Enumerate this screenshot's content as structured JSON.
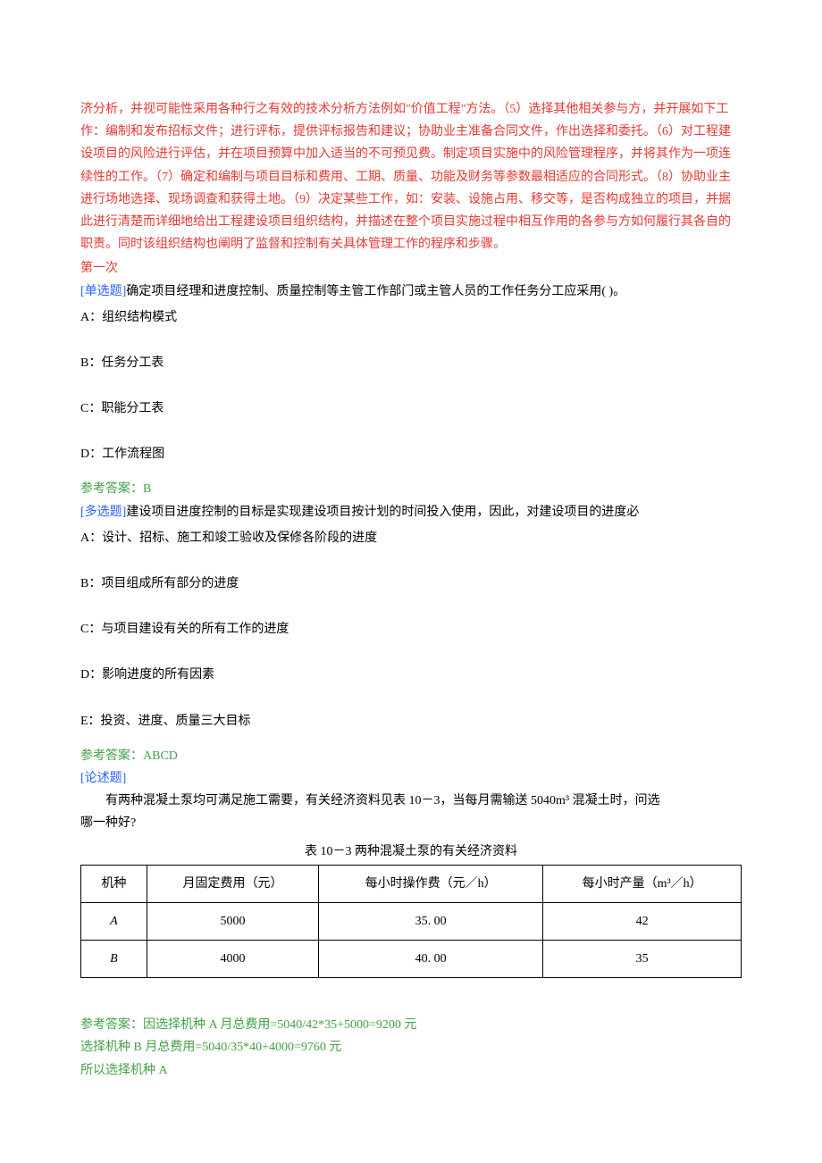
{
  "intro": {
    "red_paragraph": "济分析，并视可能性采用各种行之有效的技术分析方法例如\"价值工程\"方法。（5）选择其他相关参与方，并开展如下工作：编制和发布招标文件；进行评标，提供评标报告和建议；协助业主准备合同文件，作出选择和委托。（6）对工程建设项目的风险进行评估，并在项目预算中加入适当的不可预见费。制定项目实施中的风险管理程序，并将其作为一项连续性的工作。（7）确定和编制与项目目标和费用、工期、质量、功能及财务等参数最相适应的合同形式。（8）协助业主进行场地选择、现场调查和获得土地。（9）决定某些工作，如：安装、设施占用、移交等，是否构成独立的项目，并据此进行清楚而详细地给出工程建设项目组织结构，并描述在整个项目实施过程中相互作用的各参与方如何履行其各自的职责。同时该组织结构也阐明了监督和控制有关具体管理工作的程序和步骤。",
    "section_title": "第一次"
  },
  "q1": {
    "tag": "[单选题]",
    "stem": "确定项目经理和进度控制、质量控制等主管工作部门或主管人员的工作任务分工应采用( )。",
    "optA": "A：组织结构模式",
    "optB": "B：任务分工表",
    "optC": "C：职能分工表",
    "optD": "D：工作流程图",
    "answer_label": "参考答案：",
    "answer_value": "B"
  },
  "q2": {
    "tag": "[多选题]",
    "stem": "建设项目进度控制的目标是实现建设项目按计划的时间投入使用，因此，对建设项目的进度必",
    "optA": "A：设计、招标、施工和竣工验收及保修各阶段的进度",
    "optB": "B：项目组成所有部分的进度",
    "optC": "C：与项目建设有关的所有工作的进度",
    "optD": "D：影响进度的所有因素",
    "optE": "E：投资、进度、质量三大目标",
    "answer_label": "参考答案：",
    "answer_value": "ABCD"
  },
  "q3": {
    "tag": "[论述题]",
    "stem_line1": "有两种混凝土泵均可满足施工需要，有关经济资料见表 10－3，当每月需输送 5040m³ 混凝土时，问选",
    "stem_line2": "哪一种好?",
    "answer1": "参考答案：因选择机种 A 月总费用=5040/42*35+5000=9200 元",
    "answer2": "选择机种 B 月总费用=5040/35*40+4000=9760 元",
    "answer3": "所以选择机种 A"
  },
  "chart_data": {
    "type": "table",
    "caption": "表 10－3   两种混凝土泵的有关经济资料",
    "headers": [
      "机种",
      "月固定费用（元）",
      "每小时操作费（元／h）",
      "每小时产量（m³／h）"
    ],
    "rows": [
      {
        "machine": "A",
        "fixed_cost": "5000",
        "op_cost": "35. 00",
        "output": "42"
      },
      {
        "machine": "B",
        "fixed_cost": "4000",
        "op_cost": "40. 00",
        "output": "35"
      }
    ]
  }
}
